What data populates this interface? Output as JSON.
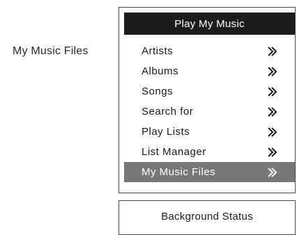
{
  "side_label": "My Music Files",
  "panel": {
    "title": "Play My Music",
    "items": [
      {
        "label": "Artists",
        "icon": "double-chevron-right-icon",
        "selected": false
      },
      {
        "label": "Albums",
        "icon": "double-chevron-right-icon",
        "selected": false
      },
      {
        "label": "Songs",
        "icon": "double-chevron-right-icon",
        "selected": false
      },
      {
        "label": "Search for",
        "icon": "double-chevron-right-icon",
        "selected": false
      },
      {
        "label": "Play Lists",
        "icon": "double-chevron-right-icon",
        "selected": false
      },
      {
        "label": "List Manager",
        "icon": "double-chevron-right-icon",
        "selected": false
      },
      {
        "label": "My Music Files",
        "icon": "double-chevron-right-icon",
        "selected": true
      }
    ]
  },
  "status": {
    "title": "Background Status"
  },
  "colors": {
    "title_bar_bg": "#1c1c1c",
    "selected_bg": "#777777",
    "text": "#1a1a1a",
    "selected_text": "#ffffff"
  }
}
